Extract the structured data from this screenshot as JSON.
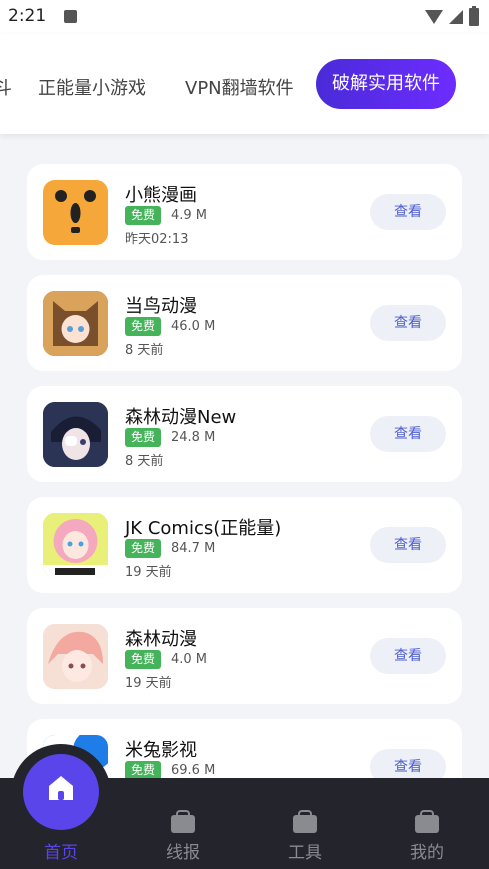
{
  "status": {
    "time": "2:21"
  },
  "tabs": [
    "斗",
    "正能量小游戏",
    "VPN翻墙软件",
    "破解实用软件"
  ],
  "apps": [
    {
      "name": "小熊漫画",
      "badge": "免费",
      "size": "4.9 M",
      "date": "昨天02:13",
      "button": "查看"
    },
    {
      "name": "当鸟动漫",
      "badge": "免费",
      "size": "46.0 M",
      "date": "8 天前",
      "button": "查看"
    },
    {
      "name": "森林动漫New",
      "badge": "免费",
      "size": "24.8 M",
      "date": "8 天前",
      "button": "查看"
    },
    {
      "name": "JK Comics(正能量)",
      "badge": "免费",
      "size": "84.7 M",
      "date": "19 天前",
      "button": "查看"
    },
    {
      "name": "森林动漫",
      "badge": "免费",
      "size": "4.0 M",
      "date": "19 天前",
      "button": "查看"
    },
    {
      "name": "米兔影视",
      "badge": "免费",
      "size": "69.6 M",
      "date": "",
      "button": "查看"
    }
  ],
  "nav": {
    "home": "首页",
    "lines": "线报",
    "tools": "工具",
    "mine": "我的"
  },
  "colors": {
    "accent": "#5a45ea",
    "badge": "#45b35a",
    "nav_bg": "#23242c"
  }
}
